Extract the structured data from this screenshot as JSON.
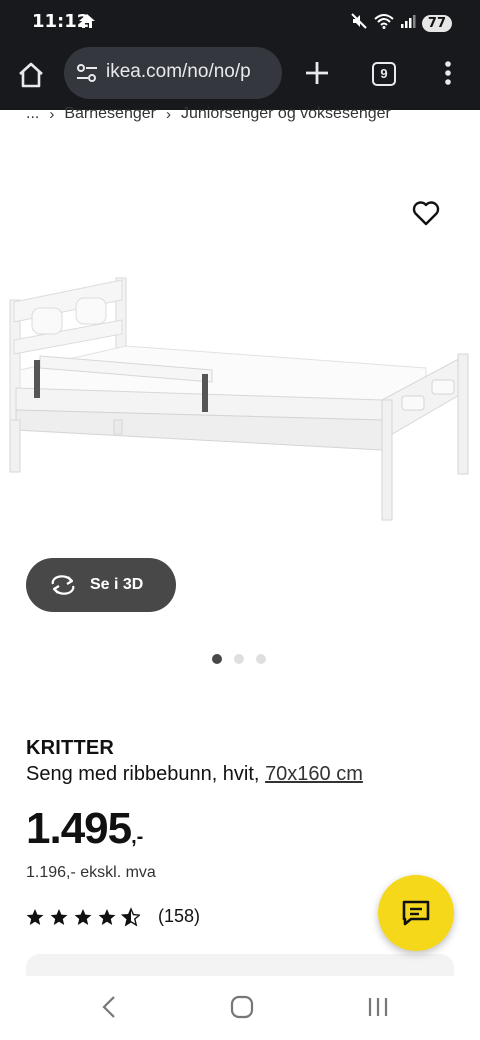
{
  "status_bar": {
    "time": "11:12",
    "battery": "77"
  },
  "browser": {
    "url": "ikea.com/no/no/p",
    "tab_count": "9"
  },
  "breadcrumb": {
    "items": [
      "...",
      "Barnesenger",
      "Juniorsenger og voksesenger"
    ]
  },
  "gallery": {
    "view_3d_label": "Se i 3D",
    "image_count": 3,
    "active_index": 0
  },
  "product": {
    "brand": "KRITTER",
    "description": "Seng med ribbebunn, hvit,",
    "size": "70x160 cm",
    "price": "1.495",
    "price_suffix": ",-",
    "price_excl_vat": "1.196,- ekskl. mva",
    "rating_value": 4.5,
    "rating_max": 5,
    "review_count": "(158)"
  },
  "colors": {
    "chrome_dark": "#17191c",
    "urlbar": "#34373d",
    "button_3d": "#484848",
    "chat_fab": "#f5d81a"
  }
}
